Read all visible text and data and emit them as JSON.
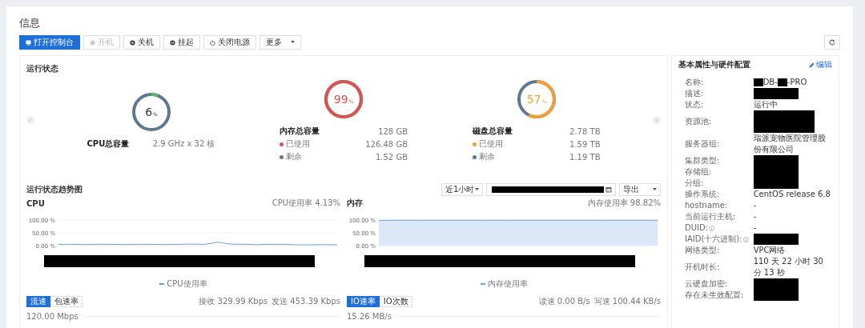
{
  "title": "信息",
  "toolbar": [
    {
      "label": "打开控制台",
      "kind": "primary",
      "disabled": false
    },
    {
      "label": "开机",
      "kind": "power-on",
      "disabled": true
    },
    {
      "label": "关机",
      "kind": "stop",
      "disabled": false
    },
    {
      "label": "挂起",
      "kind": "pause",
      "disabled": false
    },
    {
      "label": "关闭电源",
      "kind": "power",
      "disabled": false
    },
    {
      "label": "更多",
      "kind": "dropdown",
      "disabled": false
    }
  ],
  "status": {
    "title": "运行状态",
    "gauges": [
      {
        "number": "6",
        "unit": "%",
        "level": 0.06,
        "color": "#5cb85c",
        "highlight": false,
        "label": "CPU总容量",
        "total": "2.9 GHz x 32 核"
      },
      {
        "number": "99",
        "unit": "%",
        "level": 0.99,
        "color": "#d9534f",
        "highlight": true,
        "label": "内存总容量",
        "total": "128 GB",
        "parts": [
          {
            "label": "已使用",
            "value": "126.48 GB",
            "color": "#d9534f"
          },
          {
            "label": "剩余",
            "value": "1.52 GB",
            "color": "#5e7892"
          }
        ]
      },
      {
        "number": "57",
        "unit": "%",
        "level": 0.57,
        "color": "#f0a030",
        "highlight": true,
        "label": "磁盘总容量",
        "total": "2.78 TB",
        "parts": [
          {
            "label": "已使用",
            "value": "1.59 TB",
            "color": "#f0a030"
          },
          {
            "label": "剩余",
            "value": "1.19 TB",
            "color": "#5e7892"
          }
        ]
      }
    ]
  },
  "trend": {
    "title": "运行状态趋势图",
    "range": "近1小时",
    "export": "导出",
    "charts": [
      {
        "title": "CPU",
        "reading": "CPU使用率 4.13%",
        "chart_data": {
          "type": "line",
          "ylim": [
            0,
            100
          ],
          "yticks": [
            {
              "value": 0,
              "label": "0.00 %"
            },
            {
              "value": 50,
              "label": "50.00 %"
            },
            {
              "value": 100,
              "label": "100.00 %"
            }
          ],
          "series": [
            {
              "name": "CPU使用率",
              "color": "#6f9fd8",
              "values": [
                5,
                5,
                4,
                5,
                5,
                4,
                5,
                5,
                4,
                5,
                6,
                5,
                13,
                6,
                5,
                4,
                5,
                5,
                3,
                3,
                4,
                3
              ]
            }
          ]
        },
        "tabs": [
          {
            "label": "流速",
            "selected": true
          },
          {
            "label": "包速率",
            "selected": false
          }
        ],
        "stats": [
          "接收 329.99 Kbps",
          "发送 453.39 Kbps"
        ],
        "next_tick": "120.00 Mbps"
      },
      {
        "title": "内存",
        "reading": "内存使用率 98.82%",
        "chart_data": {
          "type": "line",
          "ylim": [
            0,
            100
          ],
          "yticks": [
            {
              "value": 0,
              "label": "0.00 %"
            },
            {
              "value": 50,
              "label": "50.00 %"
            },
            {
              "value": 100,
              "label": "100.00 %"
            }
          ],
          "series": [
            {
              "name": "内存使用率",
              "color": "#6f9fd8",
              "values": [
                98,
                99,
                99,
                99,
                99,
                99,
                99,
                99,
                99,
                99,
                99,
                99,
                99,
                99,
                99,
                99,
                99,
                99,
                99,
                99,
                99,
                99
              ]
            }
          ]
        },
        "tabs": [
          {
            "label": "IO速率",
            "selected": true
          },
          {
            "label": "IO次数",
            "selected": false
          }
        ],
        "stats": [
          "读速 0.00 B/s",
          "写速 100.44 KB/s"
        ],
        "next_tick": "15.26 MB/s"
      }
    ]
  },
  "properties": {
    "title": "基本属性与硬件配置",
    "edit": "编辑",
    "rows": [
      {
        "label": "名称:",
        "hint": false,
        "value": [
          {
            "kind": "mark"
          },
          {
            "kind": "text",
            "text": "DB-"
          },
          {
            "kind": "mark"
          },
          {
            "kind": "text",
            "text": "-PRO"
          }
        ]
      },
      {
        "label": "描述:",
        "hint": false,
        "value": [
          {
            "kind": "redaction",
            "tall": false
          }
        ]
      },
      {
        "label": "状态:",
        "hint": false,
        "value": [
          {
            "kind": "text",
            "text": "运行中"
          }
        ]
      },
      {
        "label": "资源池:",
        "hint": false,
        "value": [
          {
            "kind": "redaction",
            "tall": true
          }
        ]
      },
      {
        "label": "服务器组:",
        "hint": false,
        "value": [
          {
            "kind": "text",
            "text": "瑞派宠物医院管理股份有限公司"
          }
        ]
      },
      {
        "label": "集群类型:",
        "hint": false,
        "value": [
          {
            "kind": "redaction",
            "tall": false
          }
        ]
      },
      {
        "label": "存储组:",
        "hint": false,
        "value": [
          {
            "kind": "redaction",
            "tall": false
          }
        ]
      },
      {
        "label": "分组:",
        "hint": false,
        "value": [
          {
            "kind": "redaction",
            "tall": false
          }
        ]
      },
      {
        "label": "操作系统:",
        "hint": false,
        "value": [
          {
            "kind": "text",
            "text": "CentOS release 6.8"
          }
        ]
      },
      {
        "label": "hostname:",
        "hint": false,
        "value": [
          {
            "kind": "text",
            "text": "-"
          }
        ]
      },
      {
        "label": "当前运行主机:",
        "hint": false,
        "value": [
          {
            "kind": "text",
            "text": "-"
          }
        ]
      },
      {
        "label": "DUID:",
        "hint": true,
        "value": [
          {
            "kind": "text",
            "text": "-"
          }
        ]
      },
      {
        "label": "IAID(十六进制):",
        "hint": true,
        "value": [
          {
            "kind": "redaction",
            "tall": false
          }
        ]
      },
      {
        "label": "网络类型:",
        "hint": false,
        "value": [
          {
            "kind": "text",
            "text": "VPC网络"
          }
        ]
      },
      {
        "label": "开机时长:",
        "hint": false,
        "value": [
          {
            "kind": "text",
            "text": "110 天 22 小时 30 分 13 秒"
          }
        ]
      },
      {
        "label": "云硬盘加密:",
        "hint": false,
        "value": [
          {
            "kind": "redaction",
            "tall": false
          }
        ]
      },
      {
        "label": "存在未生效配置:",
        "hint": false,
        "value": [
          {
            "kind": "redaction",
            "tall": false
          }
        ]
      }
    ]
  }
}
